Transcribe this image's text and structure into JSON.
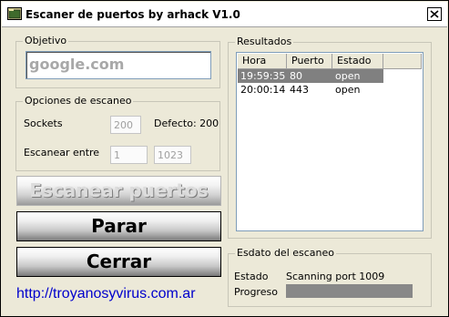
{
  "window": {
    "title": "Escaner de puertos by arhack V1.0"
  },
  "objetivo": {
    "label": "Objetivo",
    "value": "google.com"
  },
  "opciones": {
    "label": "Opciones de escaneo",
    "sockets_label": "Sockets",
    "sockets_value": "200",
    "defecto_label": "Defecto: 200",
    "rango_label": "Escanear entre",
    "rango_desde": "1",
    "rango_hasta": "1023"
  },
  "buttons": {
    "escanear": "Escanear puertos",
    "parar": "Parar",
    "cerrar": "Cerrar"
  },
  "link": "http://troyanosyvirus.com.ar",
  "resultados": {
    "label": "Resultados",
    "columns": [
      "Hora",
      "Puerto",
      "Estado"
    ],
    "rows": [
      {
        "hora": "19:59:35",
        "puerto": "80",
        "estado": "open"
      },
      {
        "hora": "20:00:14",
        "puerto": "443",
        "estado": "open"
      }
    ]
  },
  "estado": {
    "label": "Esdato del escaneo",
    "estado_label": "Estado",
    "estado_value": "Scanning port 1009",
    "progreso_label": "Progreso",
    "progress_fraction": 0
  }
}
